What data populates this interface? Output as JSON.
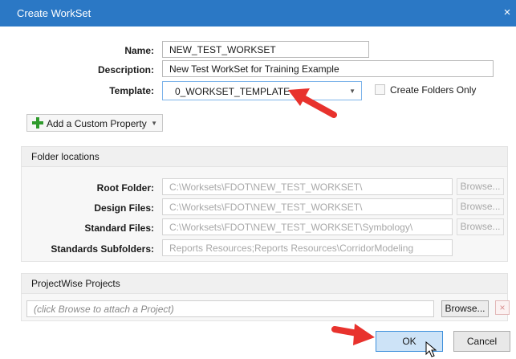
{
  "window": {
    "title": "Create WorkSet",
    "close_glyph": "×"
  },
  "form": {
    "name_label": "Name:",
    "name_value": "NEW_TEST_WORKSET",
    "description_label": "Description:",
    "description_value": "New Test WorkSet for Training Example",
    "template_label": "Template:",
    "template_value": "0_WORKSET_TEMPLATE",
    "create_folders_only_label": "Create Folders Only",
    "create_folders_only_checked": false
  },
  "add_property": {
    "label": "Add a Custom Property",
    "icon": "plus-icon"
  },
  "folder_locations": {
    "header": "Folder locations",
    "rows": [
      {
        "label": "Root Folder:",
        "value": "C:\\Worksets\\FDOT\\NEW_TEST_WORKSET\\",
        "browse": "Browse..."
      },
      {
        "label": "Design Files:",
        "value": "C:\\Worksets\\FDOT\\NEW_TEST_WORKSET\\",
        "browse": "Browse..."
      },
      {
        "label": "Standard Files:",
        "value": "C:\\Worksets\\FDOT\\NEW_TEST_WORKSET\\Symbology\\",
        "browse": "Browse..."
      },
      {
        "label": "Standards Subfolders:",
        "value": "Reports Resources;Reports Resources\\CorridorModeling"
      }
    ]
  },
  "projectwise": {
    "header": "ProjectWise Projects",
    "placeholder": "(click Browse to attach a Project)",
    "browse": "Browse...",
    "remove_glyph": "×"
  },
  "buttons": {
    "ok": "OK",
    "cancel": "Cancel"
  },
  "annotations": {
    "arrow_color": "#e8322d"
  },
  "colors": {
    "titlebar": "#2b78c5",
    "ok_button": "#cde3f7",
    "ok_border": "#3d8fdb"
  }
}
